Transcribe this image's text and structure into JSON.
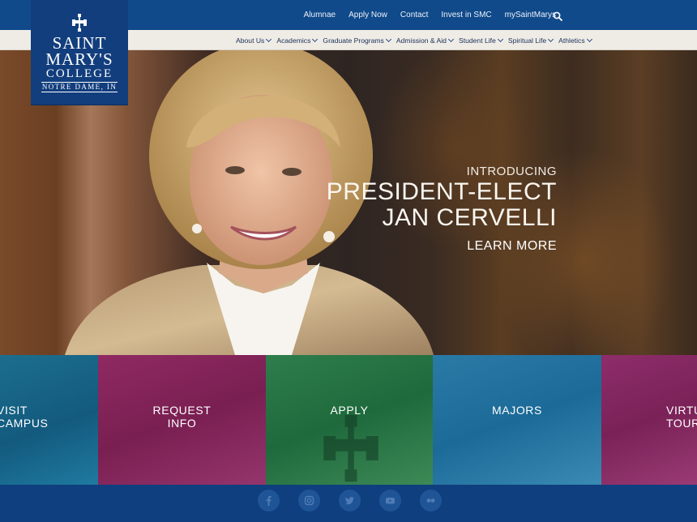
{
  "logo": {
    "line1": "SAINT",
    "line2": "MARY'S",
    "line3": "COLLEGE",
    "line4": "NOTRE DAME, IN"
  },
  "utility_nav": [
    "Alumnae",
    "Apply Now",
    "Contact",
    "Invest in SMC",
    "mySaintMarys"
  ],
  "main_nav": [
    "About Us",
    "Academics",
    "Graduate Programs",
    "Admission & Aid",
    "Student Life",
    "Spiritual Life",
    "Athletics"
  ],
  "hero": {
    "intro": "INTRODUCING",
    "title_line1": "PRESIDENT-ELECT",
    "title_line2": "JAN CERVELLI",
    "cta": "LEARN MORE"
  },
  "tiles": [
    {
      "line1": "VISIT",
      "line2": "CAMPUS"
    },
    {
      "line1": "REQUEST",
      "line2": "INFO"
    },
    {
      "line1": "APPLY",
      "line2": ""
    },
    {
      "line1": "MAJORS",
      "line2": ""
    },
    {
      "line1": "VIRTUAL",
      "line2": "TOUR"
    }
  ],
  "social": [
    "facebook-icon",
    "instagram-icon",
    "twitter-icon",
    "youtube-icon",
    "flickr-icon"
  ],
  "colors": {
    "navy": "#114a8a",
    "nav_bg": "#efece6",
    "tile_blue": "#135a7e",
    "tile_magenta": "#7a1f52",
    "tile_green": "#1f6a3c"
  }
}
